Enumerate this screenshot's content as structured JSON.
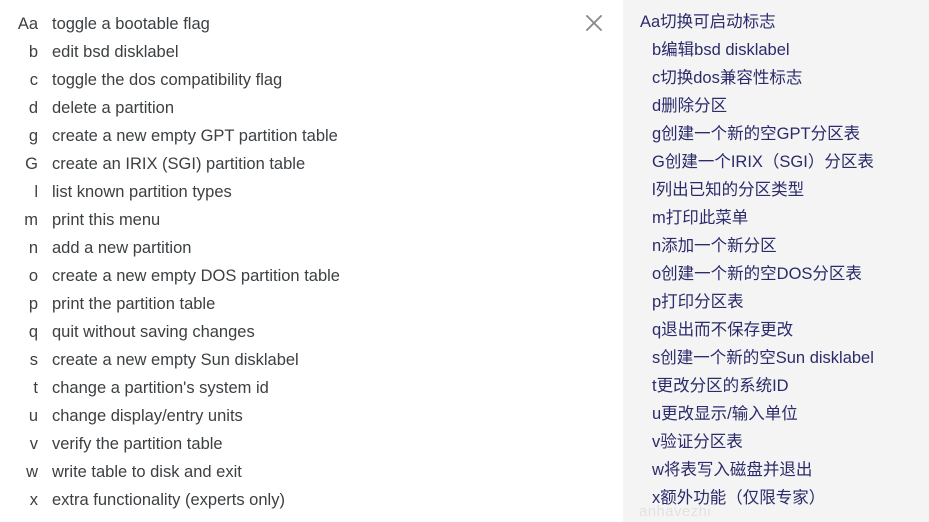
{
  "source_panel": {
    "close_icon": "close-icon",
    "rows": [
      {
        "key": "Aa",
        "desc": "toggle a bootable flag"
      },
      {
        "key": "b",
        "desc": "edit bsd disklabel"
      },
      {
        "key": "c",
        "desc": "toggle the dos compatibility flag"
      },
      {
        "key": "d",
        "desc": "delete a partition"
      },
      {
        "key": "g",
        "desc": "create a new empty GPT partition table"
      },
      {
        "key": "G",
        "desc": "create an IRIX (SGI) partition table"
      },
      {
        "key": "l",
        "desc": "list known partition types"
      },
      {
        "key": "m",
        "desc": "print this menu"
      },
      {
        "key": "n",
        "desc": "add a new partition"
      },
      {
        "key": "o",
        "desc": "create a new empty DOS partition table"
      },
      {
        "key": "p",
        "desc": "print the partition table"
      },
      {
        "key": "q",
        "desc": "quit without saving changes"
      },
      {
        "key": "s",
        "desc": "create a new empty Sun disklabel"
      },
      {
        "key": "t",
        "desc": "change a partition's system id"
      },
      {
        "key": "u",
        "desc": "change display/entry units"
      },
      {
        "key": "v",
        "desc": "verify the partition table"
      },
      {
        "key": "w",
        "desc": "write table to disk and exit"
      },
      {
        "key": "x",
        "desc": "extra functionality (experts only)"
      }
    ]
  },
  "target_panel": {
    "rows": [
      "Aa切换可启动标志",
      "b编辑bsd disklabel",
      "c切换dos兼容性标志",
      "d删除分区",
      "g创建一个新的空GPT分区表",
      "G创建一个IRIX（SGI）分区表",
      "l列出已知的分区类型",
      "m打印此菜单",
      "n添加一个新分区",
      "o创建一个新的空DOS分区表",
      "p打印分区表",
      "q退出而不保存更改",
      "s创建一个新的空Sun disklabel",
      "t更改分区的系统ID",
      "u更改显示/输入单位",
      "v验证分区表",
      "w将表写入磁盘并退出",
      "x额外功能（仅限专家）"
    ],
    "watermark": "anhavezhi"
  },
  "colors": {
    "source_text": "#3c4043",
    "source_background": "#ffffff",
    "target_text": "#2b2b6b",
    "target_background": "#f4f4f4",
    "close_icon": "#5f6368"
  }
}
